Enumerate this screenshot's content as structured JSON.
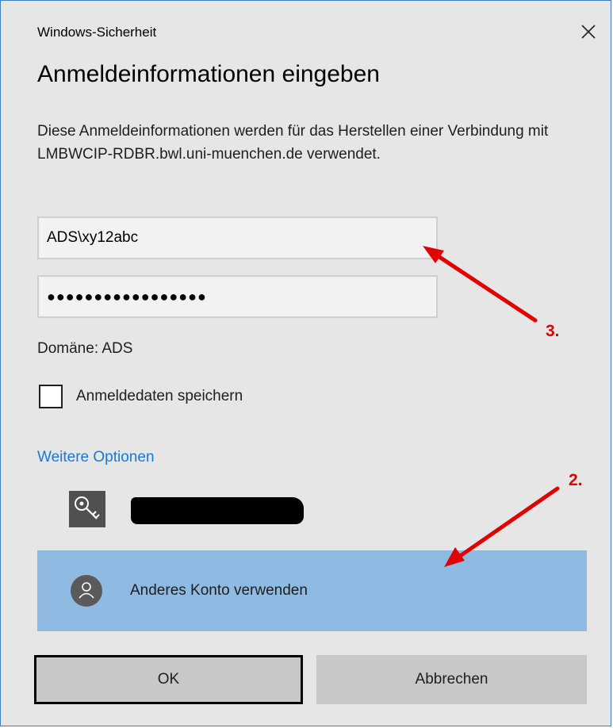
{
  "window": {
    "title": "Windows-Sicherheit",
    "heading": "Anmeldeinformationen eingeben",
    "description": "Diese Anmeldeinformationen werden für das Herstellen einer Verbindung mit LMBWCIP-RDBR.bwl.uni-muenchen.de verwendet."
  },
  "form": {
    "username_value": "ADS\\xy12abc",
    "password_mask": "●●●●●●●●●●●●●●●●●",
    "domain_text": "Domäne: ADS",
    "remember_label": "Anmeldedaten speichern",
    "remember_checked": false
  },
  "options": {
    "more_options_label": "Weitere Optionen",
    "other_account_label": "Anderes Konto verwenden"
  },
  "buttons": {
    "ok_label": "OK",
    "cancel_label": "Abbrechen"
  },
  "annotations": {
    "label_3": "3.",
    "label_2": "2.",
    "arrow_color": "#e10000"
  },
  "icons": [
    "close-icon",
    "key-icon",
    "user-avatar-icon"
  ],
  "colors": {
    "accent_link": "#1a78d2",
    "selected_row": "#8fbbe2",
    "dialog_background": "#e6e6e6"
  }
}
